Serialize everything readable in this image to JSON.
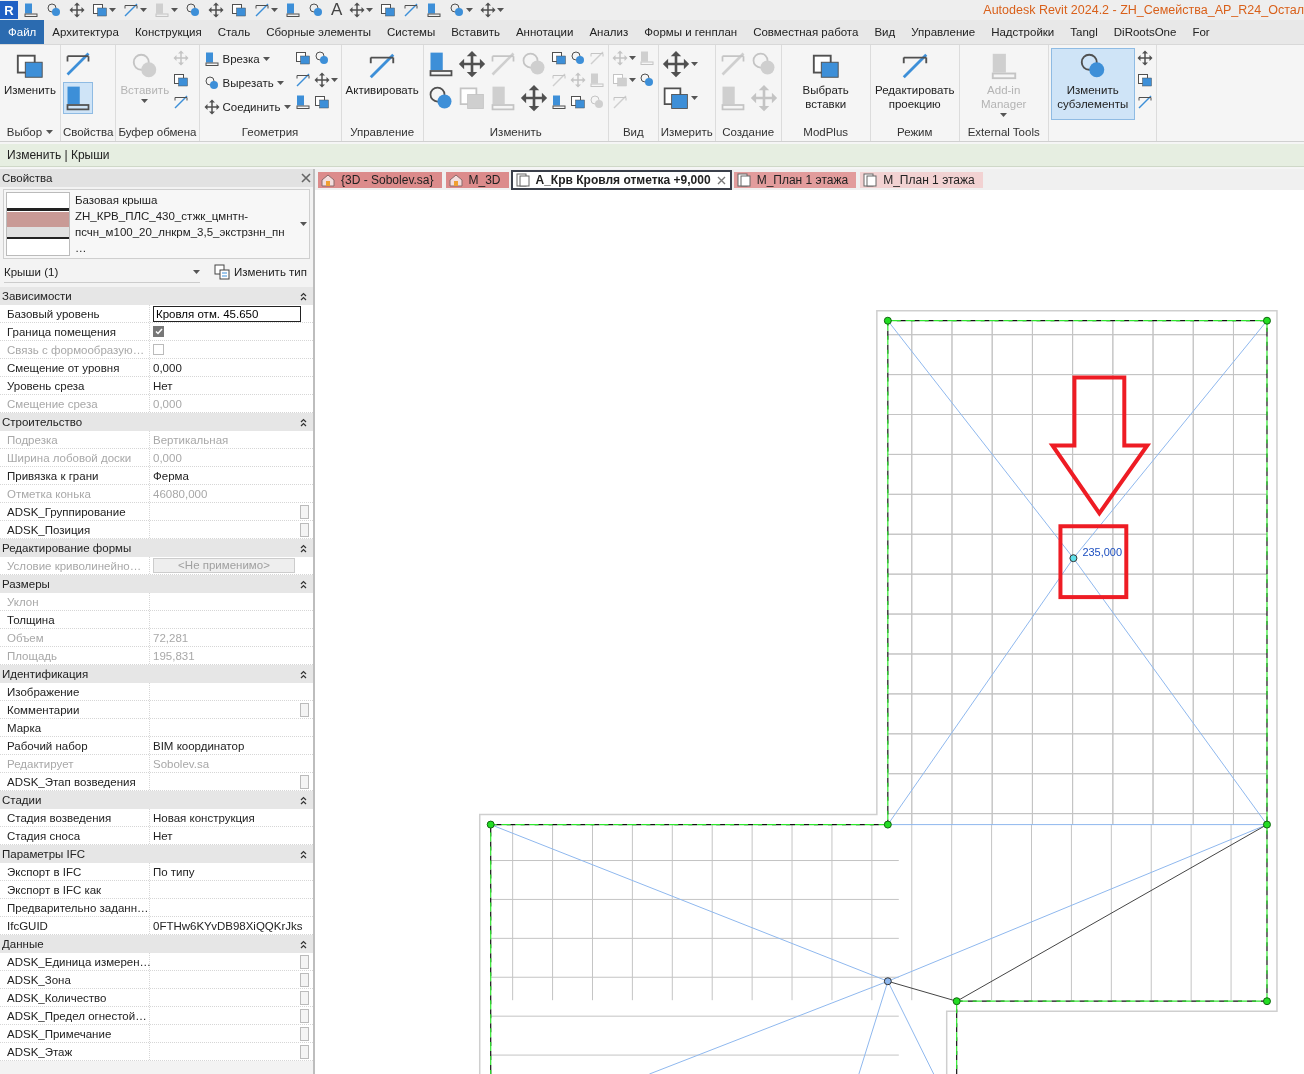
{
  "quick_access": {
    "logo": "R",
    "title": "Autodesk Revit 2024.2 - ZH_Семейства_АР_R24_Остал",
    "tools": [
      {
        "dropdown": false,
        "disabled": false
      },
      {
        "dropdown": false,
        "disabled": false
      },
      {
        "dropdown": false,
        "disabled": false
      },
      {
        "dropdown": true,
        "disabled": false
      },
      {
        "dropdown": true,
        "disabled": false
      },
      {
        "dropdown": true,
        "disabled": true
      },
      {
        "dropdown": false,
        "disabled": false
      },
      {
        "dropdown": false,
        "disabled": false
      },
      {
        "dropdown": false,
        "disabled": false
      },
      {
        "dropdown": true,
        "disabled": false
      },
      {
        "dropdown": false,
        "disabled": false
      },
      {
        "dropdown": false,
        "disabled": false
      },
      {
        "dropdown": false,
        "disabled": false,
        "glyph": "A"
      },
      {
        "dropdown": true,
        "disabled": false
      },
      {
        "dropdown": false,
        "disabled": false
      },
      {
        "dropdown": false,
        "disabled": false
      },
      {
        "dropdown": false,
        "disabled": false
      },
      {
        "dropdown": true,
        "disabled": false
      },
      {
        "dropdown": true,
        "disabled": false
      }
    ]
  },
  "menu_tabs": [
    {
      "label": "Файл",
      "selected": true
    },
    {
      "label": "Архитектура",
      "selected": false
    },
    {
      "label": "Конструкция",
      "selected": false
    },
    {
      "label": "Сталь",
      "selected": false
    },
    {
      "label": "Сборные элементы",
      "selected": false
    },
    {
      "label": "Системы",
      "selected": false
    },
    {
      "label": "Вставить",
      "selected": false
    },
    {
      "label": "Аннотации",
      "selected": false
    },
    {
      "label": "Анализ",
      "selected": false
    },
    {
      "label": "Формы и генплан",
      "selected": false
    },
    {
      "label": "Совместная работа",
      "selected": false
    },
    {
      "label": "Вид",
      "selected": false
    },
    {
      "label": "Управление",
      "selected": false
    },
    {
      "label": "Надстройки",
      "selected": false
    },
    {
      "label": "Tangl",
      "selected": false
    },
    {
      "label": "DiRootsOne",
      "selected": false
    },
    {
      "label": "For",
      "selected": false
    }
  ],
  "ribbon": [
    {
      "label": "Выбор",
      "label_dropdown": true,
      "groups": [
        {
          "kind": "big",
          "label": "Изменить",
          "dropdown": false,
          "disabled": false,
          "selected": false
        }
      ]
    },
    {
      "label": "Свойства",
      "label_dropdown": false,
      "groups": [
        {
          "kind": "stack_large",
          "items": [
            {
              "dropdown": false,
              "disabled": false,
              "selected": false
            },
            {
              "dropdown": false,
              "disabled": false,
              "selected": true
            }
          ]
        }
      ]
    },
    {
      "label": "Буфер обмена",
      "label_dropdown": false,
      "groups": [
        {
          "kind": "big",
          "label": "Вставить",
          "dropdown": true,
          "disabled": true,
          "selected": false
        },
        {
          "kind": "stack",
          "items": [
            {
              "dropdown": false,
              "disabled": true,
              "selected": false
            },
            {
              "dropdown": false,
              "disabled": false,
              "selected": false
            },
            {
              "dropdown": false,
              "disabled": false,
              "selected": false
            }
          ]
        }
      ]
    },
    {
      "label": "Геометрия",
      "label_dropdown": false,
      "groups": [
        {
          "kind": "stack",
          "items": [
            {
              "label": "Врезка",
              "dropdown": true,
              "disabled": false,
              "selected": false
            },
            {
              "label": "Вырезать",
              "dropdown": true,
              "disabled": false,
              "selected": false
            },
            {
              "label": "Соединить",
              "dropdown": true,
              "disabled": false,
              "selected": false
            }
          ]
        },
        {
          "kind": "stack",
          "items": [
            {
              "dropdown": false,
              "disabled": false,
              "selected": false
            },
            {
              "dropdown": false,
              "disabled": false,
              "selected": false
            },
            {
              "dropdown": false,
              "disabled": false,
              "selected": false
            }
          ]
        },
        {
          "kind": "stack",
          "items": [
            {
              "dropdown": false,
              "disabled": false,
              "selected": false
            },
            {
              "dropdown": true,
              "disabled": false,
              "selected": false
            },
            {
              "dropdown": false,
              "disabled": false,
              "selected": false
            }
          ]
        }
      ]
    },
    {
      "label": "Управление",
      "label_dropdown": false,
      "groups": [
        {
          "kind": "big",
          "label": "Активировать",
          "dropdown": false,
          "disabled": false,
          "selected": false
        }
      ]
    },
    {
      "label": "Изменить",
      "label_dropdown": false,
      "groups": [
        {
          "kind": "stack_large",
          "items": [
            {
              "dropdown": false,
              "disabled": false,
              "selected": false
            },
            {
              "dropdown": false,
              "disabled": false,
              "selected": false
            }
          ]
        },
        {
          "kind": "stack_large",
          "items": [
            {
              "dropdown": false,
              "disabled": false,
              "selected": false
            },
            {
              "dropdown": false,
              "disabled": true,
              "selected": false
            }
          ]
        },
        {
          "kind": "stack_large",
          "items": [
            {
              "dropdown": false,
              "disabled": true,
              "selected": false
            },
            {
              "dropdown": false,
              "disabled": true,
              "selected": false
            }
          ]
        },
        {
          "kind": "stack_large",
          "items": [
            {
              "dropdown": false,
              "disabled": true,
              "selected": false
            },
            {
              "dropdown": false,
              "disabled": false,
              "selected": false
            }
          ]
        },
        {
          "kind": "stack",
          "items": [
            {
              "dropdown": false,
              "disabled": false,
              "selected": false
            },
            {
              "dropdown": false,
              "disabled": true,
              "selected": false
            },
            {
              "dropdown": false,
              "disabled": false,
              "selected": false
            }
          ]
        },
        {
          "kind": "stack",
          "items": [
            {
              "dropdown": false,
              "disabled": false,
              "selected": false
            },
            {
              "dropdown": false,
              "disabled": true,
              "selected": false
            },
            {
              "dropdown": false,
              "disabled": false,
              "selected": false
            }
          ]
        },
        {
          "kind": "stack",
          "items": [
            {
              "dropdown": false,
              "disabled": true,
              "selected": false
            },
            {
              "dropdown": false,
              "disabled": true,
              "selected": false
            },
            {
              "dropdown": false,
              "disabled": true,
              "selected": false
            }
          ]
        }
      ]
    },
    {
      "label": "Вид",
      "label_dropdown": false,
      "groups": [
        {
          "kind": "stack",
          "items": [
            {
              "dropdown": true,
              "disabled": true,
              "selected": false
            },
            {
              "dropdown": true,
              "disabled": true,
              "selected": false
            },
            {
              "dropdown": false,
              "disabled": true,
              "selected": false
            }
          ]
        },
        {
          "kind": "stack",
          "items": [
            {
              "dropdown": false,
              "disabled": true,
              "selected": false
            },
            {
              "dropdown": false,
              "disabled": false,
              "selected": false
            }
          ]
        }
      ]
    },
    {
      "label": "Измерить",
      "label_dropdown": false,
      "groups": [
        {
          "kind": "stack_large",
          "items": [
            {
              "dropdown": true,
              "disabled": false,
              "selected": false
            },
            {
              "dropdown": true,
              "disabled": false,
              "selected": false
            }
          ]
        }
      ]
    },
    {
      "label": "Создание",
      "label_dropdown": false,
      "groups": [
        {
          "kind": "stack_large",
          "items": [
            {
              "dropdown": false,
              "disabled": true,
              "selected": false
            },
            {
              "dropdown": false,
              "disabled": true,
              "selected": false
            }
          ]
        },
        {
          "kind": "stack_large",
          "items": [
            {
              "dropdown": false,
              "disabled": true,
              "selected": false
            },
            {
              "dropdown": false,
              "disabled": true,
              "selected": false
            }
          ]
        }
      ]
    },
    {
      "label": "ModPlus",
      "label_dropdown": false,
      "groups": [
        {
          "kind": "big",
          "label": "Выбрать вставки",
          "dropdown": false,
          "disabled": false,
          "selected": false
        }
      ]
    },
    {
      "label": "Режим",
      "label_dropdown": false,
      "groups": [
        {
          "kind": "big",
          "label": "Редактировать проекцию",
          "dropdown": false,
          "disabled": false,
          "selected": false
        }
      ]
    },
    {
      "label": "External Tools",
      "label_dropdown": false,
      "groups": [
        {
          "kind": "big",
          "label": "Add-in Manager",
          "dropdown": true,
          "disabled": true,
          "selected": false
        }
      ]
    },
    {
      "groups": [
        {
          "kind": "big",
          "label": "Изменить субэлементы",
          "dropdown": false,
          "disabled": false,
          "selected": true
        },
        {
          "kind": "stack",
          "items": [
            {
              "dropdown": false,
              "disabled": false,
              "selected": false
            },
            {
              "dropdown": false,
              "disabled": false,
              "selected": false
            },
            {
              "dropdown": false,
              "disabled": false,
              "selected": false
            }
          ]
        }
      ]
    }
  ],
  "context_bar": "Изменить | Крыши",
  "properties": {
    "title": "Свойства",
    "type_family": "Базовая крыша",
    "type_name": "ZH_КРВ_ПЛС_430_стжк_цмнтн-псчн_м100_20_лнкрм_3,5_экстрзнн_пн…",
    "filter": "Крыши (1)",
    "edit_type": "Изменить тип",
    "sections": [
      {
        "title": "Зависимости",
        "expanded": true,
        "rows": [
          {
            "name": "Базовый уровень",
            "value": "Кровля отм. 45.650",
            "kind": "input",
            "disabled": false,
            "param_button": false
          },
          {
            "name": "Граница помещения",
            "kind": "checkbox",
            "checked": true,
            "disabled": false,
            "param_button": false
          },
          {
            "name": "Связь с формообразую…",
            "kind": "checkbox",
            "checked": false,
            "disabled": true,
            "param_button": false
          },
          {
            "name": "Смещение от уровня",
            "value": "0,000",
            "kind": "text",
            "disabled": false,
            "param_button": false
          },
          {
            "name": "Уровень среза",
            "value": "Нет",
            "kind": "text",
            "disabled": false,
            "param_button": false
          },
          {
            "name": "Смещение среза",
            "value": "0,000",
            "kind": "text",
            "disabled": true,
            "param_button": false
          }
        ]
      },
      {
        "title": "Строительство",
        "expanded": true,
        "rows": [
          {
            "name": "Подрезка",
            "value": "Вертикальная",
            "kind": "text",
            "disabled": true,
            "param_button": false
          },
          {
            "name": "Ширина лобовой доски",
            "value": "0,000",
            "kind": "text",
            "disabled": true,
            "param_button": false
          },
          {
            "name": "Привязка к грани",
            "value": "Ферма",
            "kind": "text",
            "disabled": false,
            "param_button": false
          },
          {
            "name": "Отметка конька",
            "value": "46080,000",
            "kind": "text",
            "disabled": true,
            "param_button": false
          },
          {
            "name": "ADSK_Группирование",
            "kind": "text",
            "disabled": false,
            "param_button": true
          },
          {
            "name": "ADSK_Позиция",
            "kind": "text",
            "disabled": false,
            "param_button": true
          }
        ]
      },
      {
        "title": "Редактирование формы",
        "expanded": true,
        "rows": [
          {
            "name": "Условие криволинейно…",
            "value": "<Не применимо>",
            "kind": "button",
            "disabled": true,
            "param_button": false
          }
        ]
      },
      {
        "title": "Размеры",
        "expanded": true,
        "rows": [
          {
            "name": "Уклон",
            "kind": "text",
            "disabled": true,
            "param_button": false
          },
          {
            "name": "Толщина",
            "kind": "text",
            "disabled": false,
            "param_button": false
          },
          {
            "name": "Объем",
            "value": "72,281",
            "kind": "text",
            "disabled": true,
            "param_button": false
          },
          {
            "name": "Площадь",
            "value": "195,831",
            "kind": "text",
            "disabled": true,
            "param_button": false
          }
        ]
      },
      {
        "title": "Идентификация",
        "expanded": true,
        "rows": [
          {
            "name": "Изображение",
            "kind": "text",
            "disabled": false,
            "param_button": false
          },
          {
            "name": "Комментарии",
            "kind": "text",
            "disabled": false,
            "param_button": true
          },
          {
            "name": "Марка",
            "kind": "text",
            "disabled": false,
            "param_button": false
          },
          {
            "name": "Рабочий набор",
            "value": "BIM координатор",
            "kind": "text",
            "disabled": false,
            "param_button": false
          },
          {
            "name": "Редактирует",
            "value": "Sobolev.sa",
            "kind": "text",
            "disabled": true,
            "param_button": false
          },
          {
            "name": "ADSK_Этап возведения",
            "kind": "text",
            "disabled": false,
            "param_button": true
          }
        ]
      },
      {
        "title": "Стадии",
        "expanded": true,
        "rows": [
          {
            "name": "Стадия возведения",
            "value": "Новая конструкция",
            "kind": "text",
            "disabled": false,
            "param_button": false
          },
          {
            "name": "Стадия сноса",
            "value": "Нет",
            "kind": "text",
            "disabled": false,
            "param_button": false
          }
        ]
      },
      {
        "title": "Параметры IFC",
        "expanded": true,
        "rows": [
          {
            "name": "Экспорт в IFC",
            "value": "По типу",
            "kind": "text",
            "disabled": false,
            "param_button": false
          },
          {
            "name": "Экспорт в IFC как",
            "kind": "text",
            "disabled": false,
            "param_button": false
          },
          {
            "name": "Предварительно заданн…",
            "kind": "text",
            "disabled": false,
            "param_button": false
          },
          {
            "name": "IfcGUID",
            "value": "0FTHw6KYvDB98XiQQKrJks",
            "kind": "text",
            "disabled": false,
            "param_button": false
          }
        ]
      },
      {
        "title": "Данные",
        "expanded": true,
        "rows": [
          {
            "name": "ADSK_Единица измерен…",
            "kind": "text",
            "disabled": false,
            "param_button": true
          },
          {
            "name": "ADSK_Зона",
            "kind": "text",
            "disabled": false,
            "param_button": true
          },
          {
            "name": "ADSK_Количество",
            "kind": "text",
            "disabled": false,
            "param_button": true
          },
          {
            "name": "ADSK_Предел огнестой…",
            "kind": "text",
            "disabled": false,
            "param_button": true
          },
          {
            "name": "ADSK_Примечание",
            "kind": "text",
            "disabled": false,
            "param_button": true
          },
          {
            "name": "ADSK_Этаж",
            "kind": "text",
            "disabled": false,
            "param_button": true
          }
        ]
      }
    ]
  },
  "view_tabs": [
    {
      "label": "{3D - Sobolev.sa}",
      "kind": "model",
      "selected": false,
      "color": "#dc8b8b"
    },
    {
      "label": "M_3D",
      "kind": "model",
      "selected": false,
      "color": "#dc8b8b"
    },
    {
      "label": "А_Крв Кровля отметка +9,000",
      "kind": "plan",
      "selected": true
    },
    {
      "label": "М_План 1 этажа",
      "kind": "plan",
      "selected": false,
      "color": "#e29c9c"
    },
    {
      "label": "М_План 1 этажа",
      "kind": "plan",
      "selected": false,
      "color": "#f2d2d2"
    }
  ],
  "canvas": {
    "value_label": "235,000"
  }
}
